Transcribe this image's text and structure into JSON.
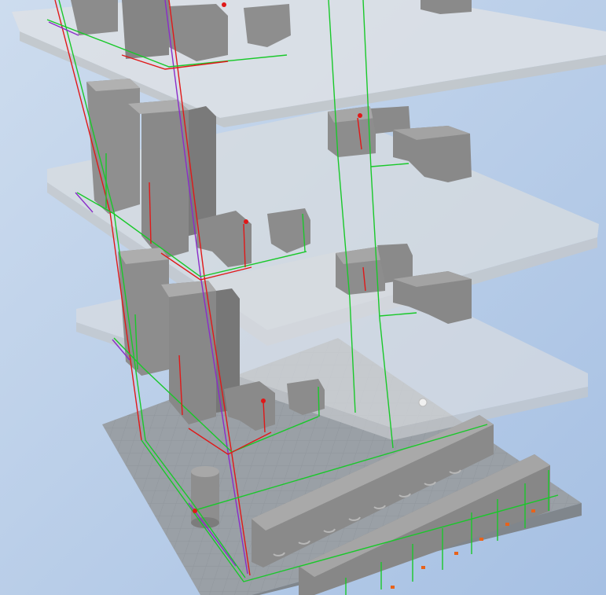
{
  "viewport": {
    "kind": "3d-simulation-viewport",
    "background_top": "#c4d5ea",
    "background_bottom": "#a9c2e4"
  },
  "scene": {
    "shelf_levels": 4,
    "shelf_color": "#d8dadb",
    "floor_color": "#9aa0a6",
    "floor_grid_color": "#8a9097",
    "part_color": "#8e8e8e",
    "part_dark_color": "#6f6f6f",
    "link_colors": {
      "green": "#19c82a",
      "red": "#e01818",
      "purple": "#8a2cc9",
      "orange": "#e8631a"
    }
  }
}
